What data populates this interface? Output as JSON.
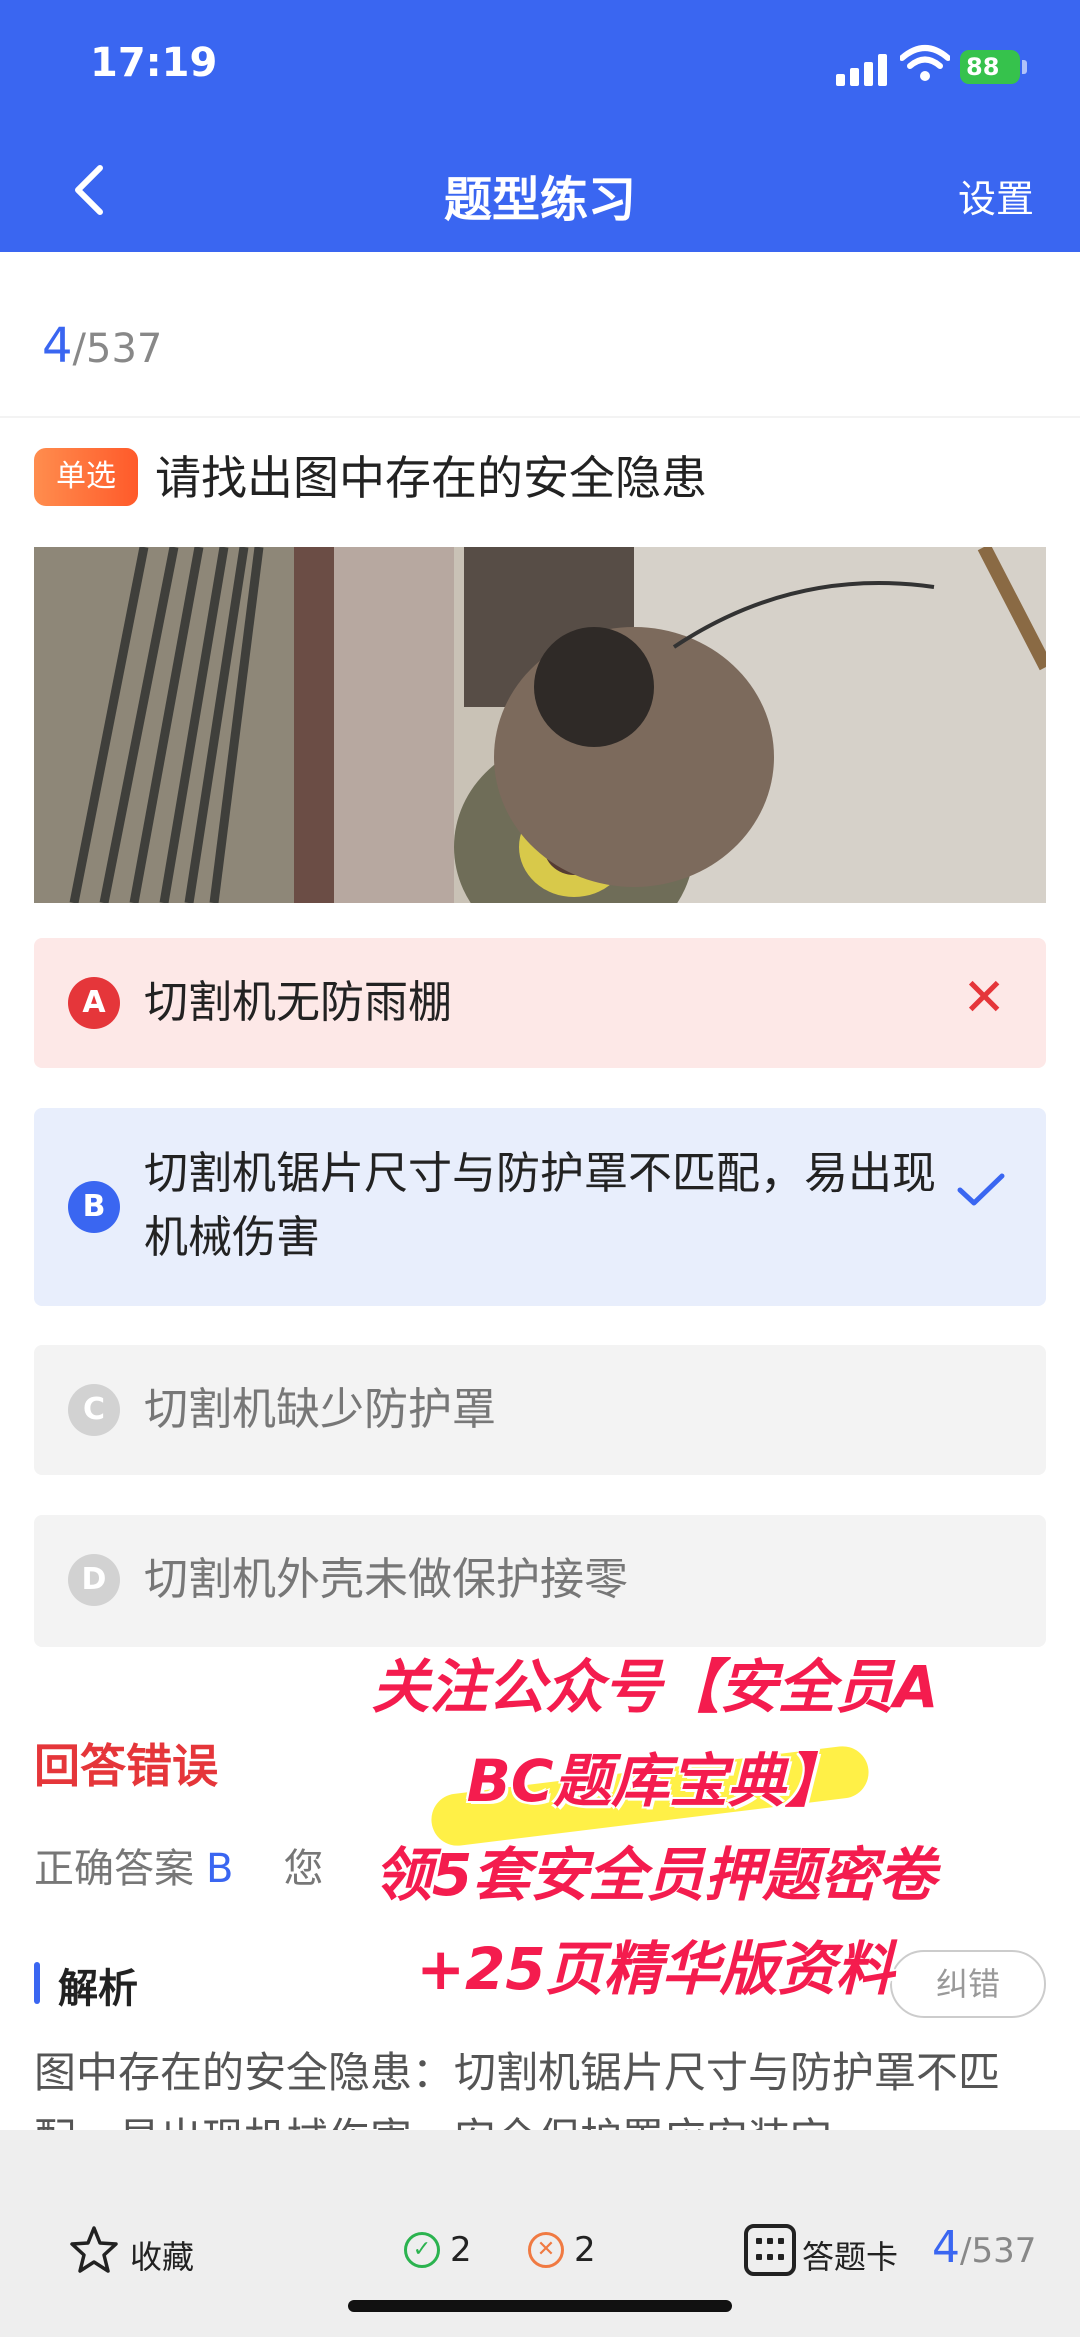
{
  "status": {
    "time": "17:19",
    "battery": "88"
  },
  "header": {
    "title": "题型练习",
    "settings": "设置"
  },
  "progress": {
    "current": "4",
    "total": "/537"
  },
  "question": {
    "type_tag": "单选",
    "text": "请找出图中存在的安全隐患"
  },
  "options": [
    {
      "letter": "A",
      "text": "切割机无防雨棚",
      "state": "wrong"
    },
    {
      "letter": "B",
      "text": "切割机锯片尺寸与防护罩不匹配，易出现机械伤害",
      "state": "correct"
    },
    {
      "letter": "C",
      "text": "切割机缺少防护罩",
      "state": "normal"
    },
    {
      "letter": "D",
      "text": "切割机外壳未做保护接零",
      "state": "normal"
    }
  ],
  "result": {
    "status": "回答错误",
    "correct_label": "正确答案",
    "correct_value": "B",
    "yours_partial": "您"
  },
  "analysis": {
    "title": "解析",
    "report": "纠错",
    "text": "图中存在的安全隐患：切割机锯片尺寸与防护罩不匹配，易出现机械伤害。安全保护罩应安装完"
  },
  "promo": {
    "line1": "关注公众号【安全员A",
    "line2": "BC题库宝典】",
    "line3": "领5套安全员押题密卷",
    "line4": "+25页精华版资料"
  },
  "bottom": {
    "favorite": "收藏",
    "correct_count": "2",
    "wrong_count": "2",
    "answer_card": "答题卡",
    "current": "4",
    "total": "/537"
  },
  "colors": {
    "primary": "#3a66f1",
    "error": "#e5363a",
    "success": "#2bb34f",
    "tag": "#ff6a35"
  }
}
